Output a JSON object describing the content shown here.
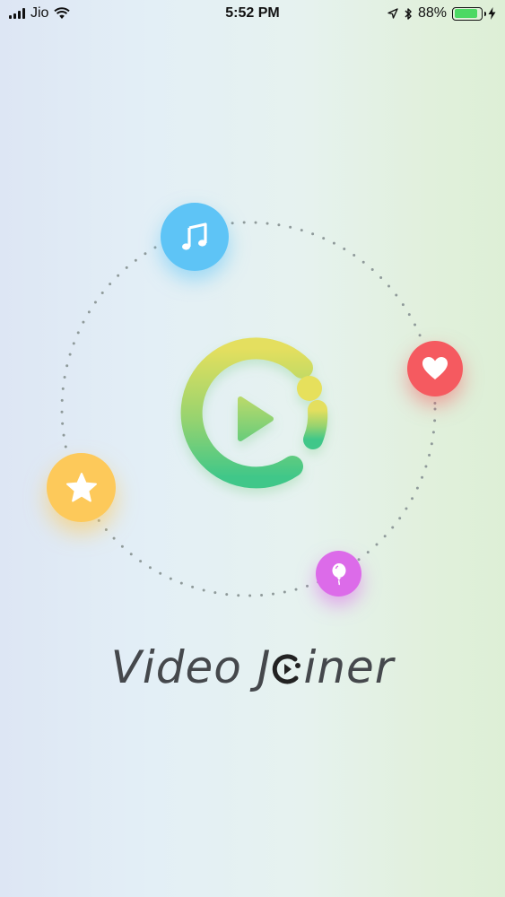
{
  "status_bar": {
    "carrier": "Jio",
    "time": "5:52 PM",
    "battery_percent": "88%",
    "battery_level": 0.88
  },
  "app": {
    "title_before": "Video J",
    "title_after": "iner"
  },
  "icons": [
    "music-note-icon",
    "heart-icon",
    "star-icon",
    "balloon-icon",
    "play-icon"
  ],
  "colors": {
    "music": "#5ec4f6",
    "heart": "#f55a60",
    "star": "#fdc95a",
    "balloon": "#dc6be9",
    "logo_gradient_top": "#e4df5e",
    "logo_gradient_bottom": "#3fc789",
    "title": "#45484c"
  }
}
